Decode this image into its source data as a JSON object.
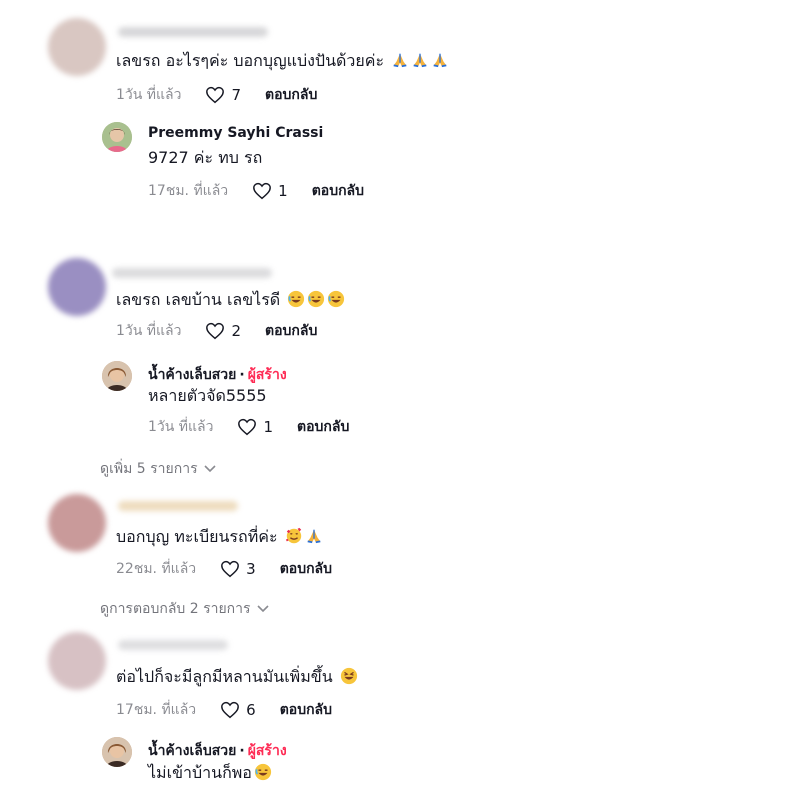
{
  "comments": [
    {
      "text": "เลขรถ อะไรๆค่ะ บอกบุญแบ่งปันด้วยค่ะ",
      "emoji": [
        "folded-hands",
        "folded-hands",
        "folded-hands"
      ],
      "time": "1วัน ที่แล้ว",
      "likes": "7",
      "reply_label": "ตอบกลับ",
      "replies": [
        {
          "name": "Preemmy Sayhi Crassi",
          "creator_badge": "",
          "text": "9727 ค่ะ ทบ รถ",
          "time": "17ชม. ที่แล้ว",
          "likes": "1",
          "reply_label": "ตอบกลับ"
        }
      ]
    },
    {
      "text": "เลขรถ เลขบ้าน เลขไรดี",
      "emoji": [
        "grinning-sweat",
        "grinning-sweat",
        "grinning-sweat"
      ],
      "time": "1วัน ที่แล้ว",
      "likes": "2",
      "reply_label": "ตอบกลับ",
      "replies": [
        {
          "name": "น้ำค้างเล็บสวย",
          "creator_badge": "ผู้สร้าง",
          "text": "หลายตัวจัด5555",
          "time": "1วัน ที่แล้ว",
          "likes": "1",
          "reply_label": "ตอบกลับ"
        }
      ],
      "more_label": "ดูเพิ่ม 5 รายการ"
    },
    {
      "text": "บอกบุญ ทะเบียนรถที่ค่ะ",
      "emoji": [
        "smiling-hearts",
        "folded-hands"
      ],
      "time": "22ชม. ที่แล้ว",
      "likes": "3",
      "reply_label": "ตอบกลับ",
      "more_label": "ดูการตอบกลับ 2 รายการ"
    },
    {
      "text": "ต่อไปก็จะมีลูกมีหลานมันเพิ่มขึ้น",
      "emoji": [
        "laughing-face"
      ],
      "time": "17ชม. ที่แล้ว",
      "likes": "6",
      "reply_label": "ตอบกลับ",
      "replies": [
        {
          "name": "น้ำค้างเล็บสวย",
          "creator_badge": "ผู้สร้าง",
          "text": "ไม่เข้าบ้านก็พอ",
          "emoji": [
            "grinning-sweat"
          ]
        }
      ]
    }
  ],
  "colors": {
    "creator": "#fe2c55",
    "secondary_text": "#8a8b91",
    "primary_text": "#161823"
  }
}
